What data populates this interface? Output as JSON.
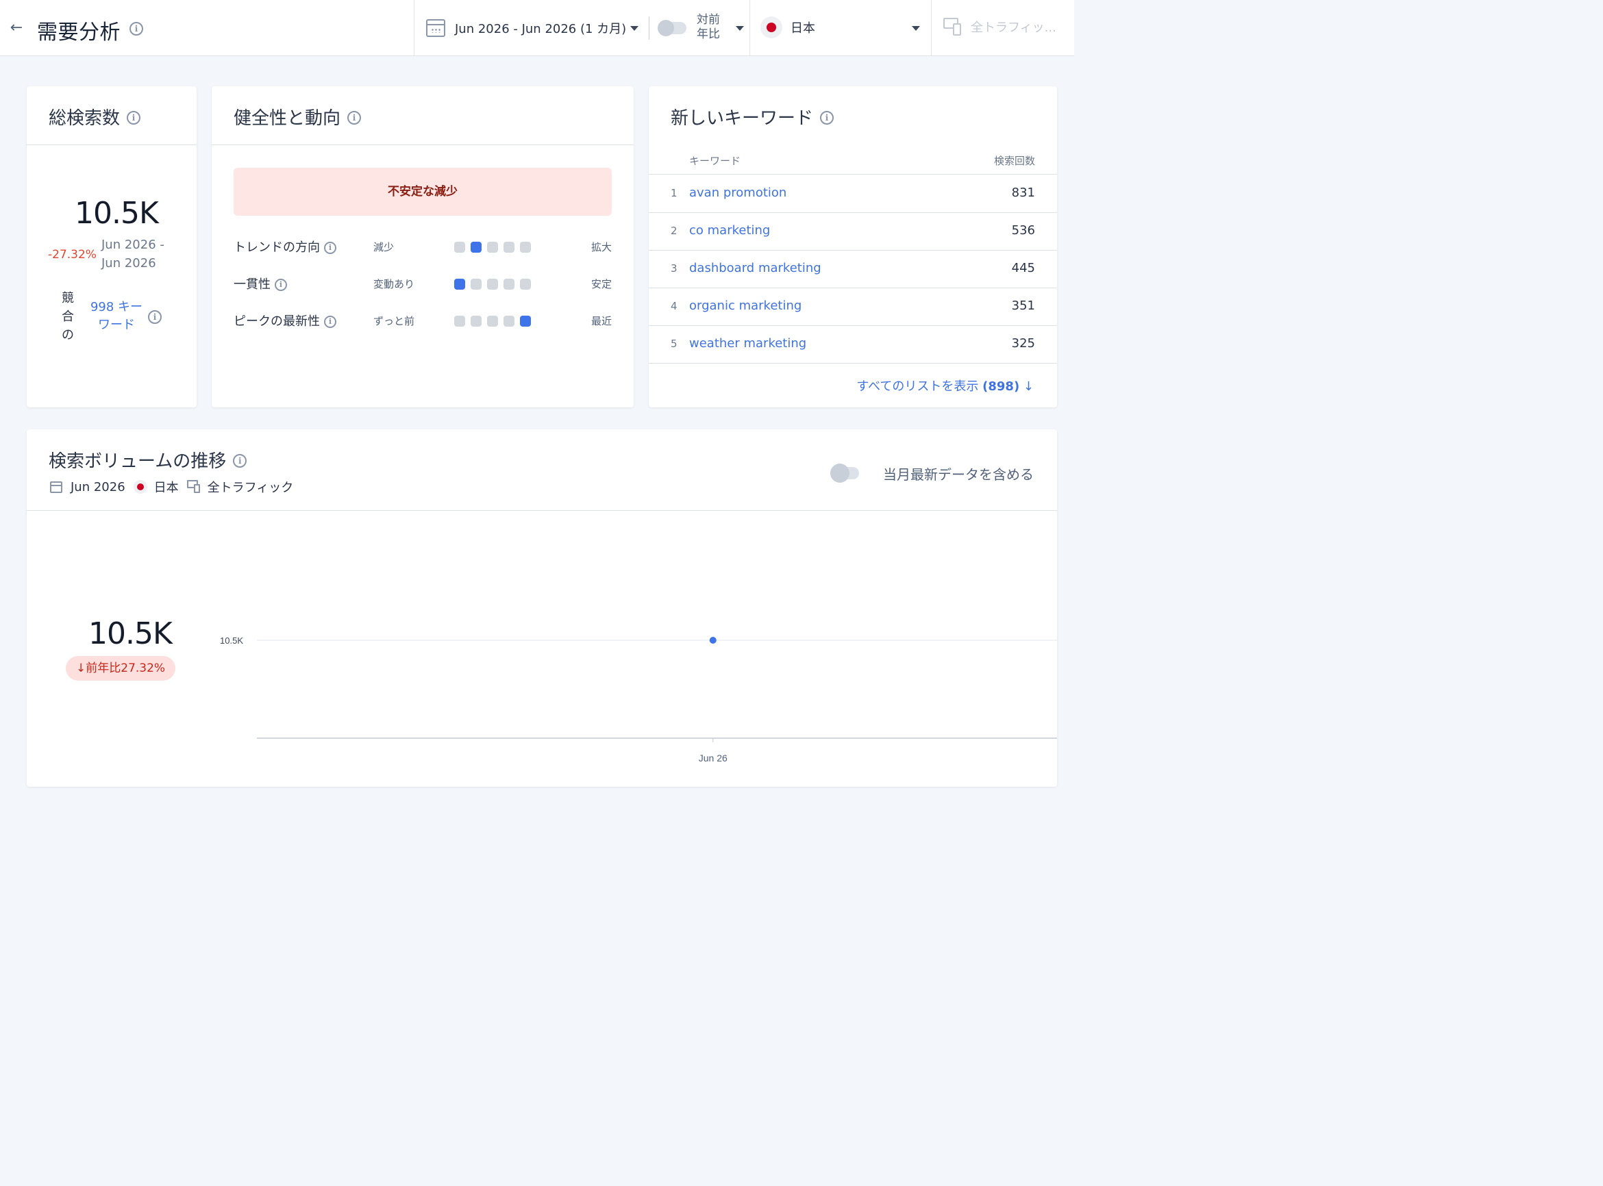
{
  "header": {
    "title": "需要分析",
    "date_range": "Jun 2026 - Jun 2026 (1 カ月)",
    "yoy_label": "対前年比",
    "country": "日本",
    "traffic": "全トラフィッ..."
  },
  "total": {
    "title": "総検索数",
    "value": "10.5K",
    "change": "-27.32%",
    "period": "Jun 2026 - Jun 2026",
    "competitor_label": "競合の",
    "competitor_keywords": "998 キーワード"
  },
  "health": {
    "title": "健全性と動向",
    "status": "不安定な減少",
    "metrics": [
      {
        "label": "トレンドの方向",
        "low": "減少",
        "high": "拡大",
        "level": 2
      },
      {
        "label": "一貫性",
        "low": "変動あり",
        "high": "安定",
        "level": 1
      },
      {
        "label": "ピークの最新性",
        "low": "ずっと前",
        "high": "最近",
        "level": 5
      }
    ]
  },
  "keywords": {
    "title": "新しいキーワード",
    "col_keyword": "キーワード",
    "col_volume": "検索回数",
    "rows": [
      {
        "rank": "1",
        "keyword": "avan promotion",
        "volume": "831"
      },
      {
        "rank": "2",
        "keyword": "co marketing",
        "volume": "536"
      },
      {
        "rank": "3",
        "keyword": "dashboard marketing",
        "volume": "445"
      },
      {
        "rank": "4",
        "keyword": "organic marketing",
        "volume": "351"
      },
      {
        "rank": "5",
        "keyword": "weather marketing",
        "volume": "325"
      }
    ],
    "view_all": "すべてのリストを表示",
    "view_all_count": "(898)"
  },
  "volume": {
    "title": "検索ボリュームの推移",
    "meta_date": "Jun 2026",
    "meta_country": "日本",
    "meta_traffic": "全トラフィック",
    "include_label": "当月最新データを含める",
    "value": "10.5K",
    "yoy": "前年比27.32%"
  },
  "chart_data": {
    "type": "line",
    "x": [
      "Jun 26"
    ],
    "series": [
      {
        "values": [
          10500
        ]
      }
    ],
    "y_tick_labels": [
      "10.5K"
    ],
    "grid": true,
    "color": "#3e73ea"
  }
}
